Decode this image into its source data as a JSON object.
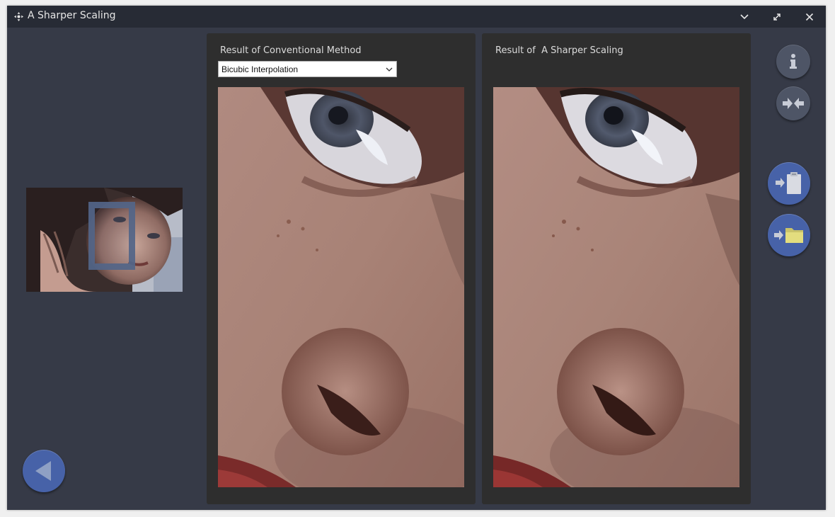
{
  "window": {
    "title": "A Sharper Scaling"
  },
  "titlebar_buttons": {
    "minimize_icon": "chevron-down-icon",
    "maximize_icon": "expand-icon",
    "close_icon": "close-icon"
  },
  "panels": {
    "left": {
      "title": "Result of Conventional Method",
      "method_selected": "Bicubic Interpolation"
    },
    "right": {
      "title": "Result of  A Sharper Scaling"
    }
  },
  "side_buttons": [
    {
      "name": "info",
      "icon": "info-icon"
    },
    {
      "name": "compare",
      "icon": "arrows-converge-icon"
    },
    {
      "name": "paste",
      "icon": "paste-clipboard-icon"
    },
    {
      "name": "open",
      "icon": "open-folder-icon"
    }
  ],
  "back_button": {
    "icon": "back-arrow-icon"
  },
  "colors": {
    "window_bg": "#363a47",
    "titlebar_bg": "#272b35",
    "panel_bg": "#2e2e2e",
    "accent_blue": "#4762a8",
    "button_grey": "#4e5566",
    "selection_rect": "#536588"
  }
}
